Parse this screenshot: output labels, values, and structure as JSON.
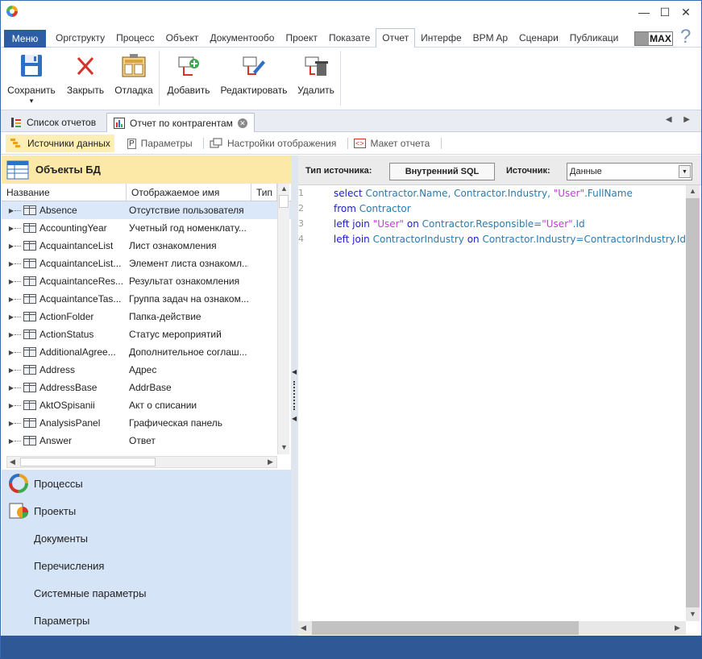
{
  "window": {
    "minimize": "—",
    "maximize": "☐",
    "close": "✕"
  },
  "menu_button": "Меню",
  "ribbon_tabs": [
    "Оргструкту",
    "Процесс",
    "Объект",
    "Документообо",
    "Проект",
    "Показате",
    "Отчет",
    "Интерфе",
    "BPM Ap",
    "Сценари",
    "Публикаци"
  ],
  "active_ribbon_tab": "Отчет",
  "max_badge": "MAX",
  "help": "?",
  "ribbon": {
    "save": "Сохранить",
    "save_arrow": "▾",
    "close": "Закрыть",
    "debug": "Отладка",
    "add": "Добавить",
    "edit": "Редактировать",
    "delete": "Удалить"
  },
  "doc_tabs": {
    "list": "Список отчетов",
    "active": "Отчет по контрагентам",
    "close": "✕",
    "nav": "◀ ▶"
  },
  "sub_tabs": {
    "sources": "Источники данных",
    "params": "Параметры",
    "display": "Настройки отображения",
    "layout": "Макет отчета"
  },
  "left": {
    "title": "Объекты БД",
    "columns": [
      "Название",
      "Отображаемое имя",
      "Тип"
    ],
    "rows": [
      {
        "name": "Absence",
        "display": "Отсутствие пользователя"
      },
      {
        "name": "AccountingYear",
        "display": "Учетный год номенклату..."
      },
      {
        "name": "AcquaintanceList",
        "display": "Лист ознакомления"
      },
      {
        "name": "AcquaintanceList...",
        "display": "Элемент листа ознакомл..."
      },
      {
        "name": "AcquaintanceRes...",
        "display": "Результат ознакомления"
      },
      {
        "name": "AcquaintanceTas...",
        "display": "Группа задач на ознаком..."
      },
      {
        "name": "ActionFolder",
        "display": "Папка-действие"
      },
      {
        "name": "ActionStatus",
        "display": "Статус мероприятий"
      },
      {
        "name": "AdditionalAgree...",
        "display": "Дополнительное соглаш..."
      },
      {
        "name": "Address",
        "display": "Адрес"
      },
      {
        "name": "AddressBase",
        "display": "AddrBase"
      },
      {
        "name": "AktOSpisanii",
        "display": "Акт о списании"
      },
      {
        "name": "AnalysisPanel",
        "display": "Графическая панель"
      },
      {
        "name": "Answer",
        "display": "Ответ"
      }
    ],
    "nav": [
      "Процессы",
      "Проекты",
      "Документы",
      "Перечисления",
      "Системные параметры",
      "Параметры"
    ]
  },
  "right": {
    "source_type_label": "Тип источника:",
    "source_type_value": "Внутренний SQL",
    "source_label": "Источник:",
    "source_value": "Данные",
    "code": [
      {
        "n": "1",
        "parts": [
          [
            "kw",
            "select "
          ],
          [
            "id",
            "Contractor.Name, Contractor.Industry, "
          ],
          [
            "str",
            "\"User\""
          ],
          [
            "id",
            ".FullName"
          ]
        ]
      },
      {
        "n": "2",
        "parts": [
          [
            "kw",
            "from "
          ],
          [
            "id",
            "Contractor"
          ]
        ]
      },
      {
        "n": "3",
        "parts": [
          [
            "kw",
            "left join "
          ],
          [
            "str",
            "\"User\""
          ],
          [
            "kw",
            " on "
          ],
          [
            "id",
            "Contractor.Responsible="
          ],
          [
            "str",
            "\"User\""
          ],
          [
            "id",
            ".Id"
          ]
        ]
      },
      {
        "n": "4",
        "parts": [
          [
            "kw",
            "left join "
          ],
          [
            "id",
            "ContractorIndustry "
          ],
          [
            "kw",
            "on "
          ],
          [
            "id",
            "Contractor.Industry=ContractorIndustry.Id"
          ]
        ]
      }
    ]
  },
  "colors": {
    "accent": "#2d5ea5",
    "selected_subtab": "#fdeeb5",
    "nav_bg": "#d5e4f6",
    "status_bar": "#2f5897"
  }
}
